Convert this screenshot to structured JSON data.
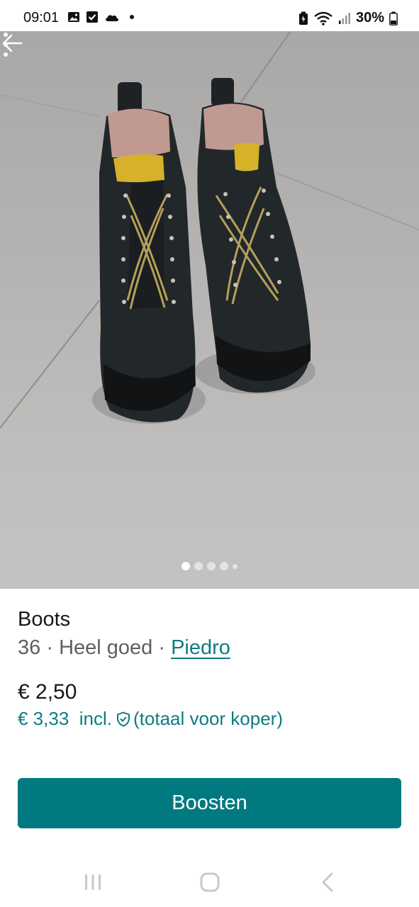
{
  "status_bar": {
    "time": "09:01",
    "battery": "30%",
    "icons_left": [
      "gallery-icon",
      "checkbox-icon",
      "cloud-icon",
      "dot"
    ],
    "icons_right": [
      "battery-saver-icon",
      "wifi-icon",
      "signal-icon",
      "battery-icon"
    ]
  },
  "photo": {
    "image_count": 5,
    "active_index": 0
  },
  "listing": {
    "title": "Boots",
    "size": "36",
    "separator": "·",
    "condition": "Heel goed",
    "brand": "Piedro",
    "price": "€ 2,50",
    "price_incl": "€ 3,33",
    "incl_label": "incl.",
    "incl_note": "(totaal voor koper)"
  },
  "actions": {
    "boost_label": "Boosten"
  },
  "colors": {
    "accent": "#007a80",
    "link": "#0f7b82"
  }
}
